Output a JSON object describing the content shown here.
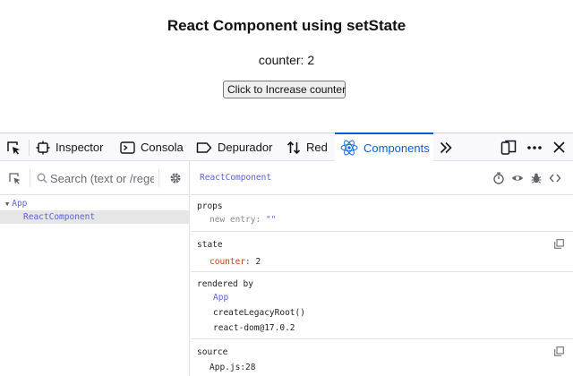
{
  "page": {
    "title": "React Component using setState",
    "counter_text": "counter: 2",
    "button_label": "Click to Increase counter"
  },
  "devtools": {
    "tabs": [
      {
        "label": "Inspector",
        "icon": "inspector-icon"
      },
      {
        "label": "Consola",
        "icon": "console-icon"
      },
      {
        "label": "Depurador",
        "icon": "debugger-icon"
      },
      {
        "label": "Red",
        "icon": "network-icon"
      },
      {
        "label": "Components",
        "icon": "react-icon",
        "active": true
      }
    ],
    "accent": "#0060df"
  },
  "react_panel": {
    "search_placeholder": "Search (text or /regex/)",
    "tree": {
      "root": "App",
      "child": "ReactComponent"
    },
    "selected": "ReactComponent",
    "props": {
      "heading": "props",
      "key": "new entry",
      "value": "\"\""
    },
    "state": {
      "heading": "state",
      "key": "counter",
      "value": "2"
    },
    "rendered_by": {
      "heading": "rendered by",
      "items": [
        "App",
        "createLegacyRoot()",
        "react-dom@17.0.2"
      ]
    },
    "source": {
      "heading": "source",
      "file": "App.js:28"
    }
  }
}
